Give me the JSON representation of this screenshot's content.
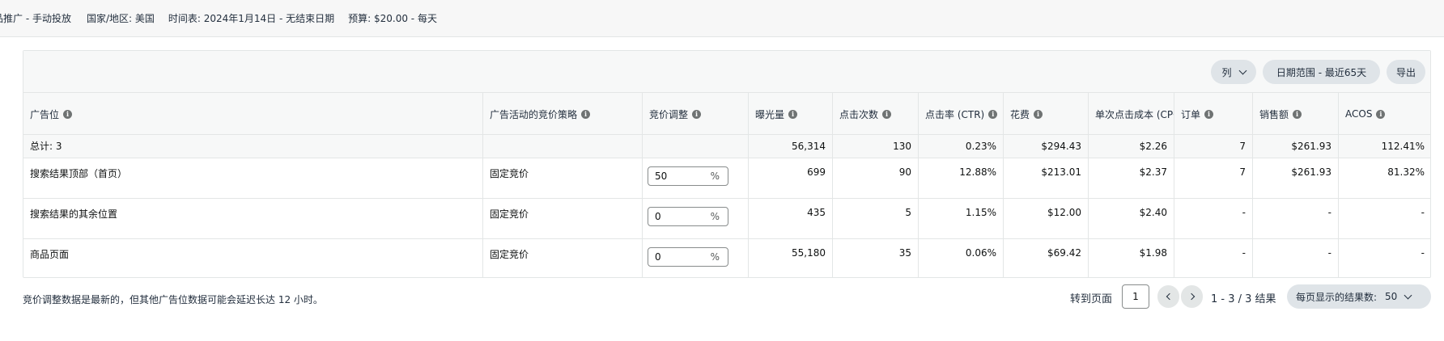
{
  "header": {
    "campaign_type": "品推广 - 手动投放",
    "country": "国家/地区: 美国",
    "schedule": "时间表: 2024年1月14日 - 无结束日期",
    "budget": "预算: $20.00 - 每天"
  },
  "toolbar": {
    "columns_label": "列",
    "date_range_label": "日期范围 - 最近65天",
    "export_label": "导出"
  },
  "table": {
    "headers": [
      "广告位",
      "广告活动的竞价策略",
      "竞价调整",
      "曝光量",
      "点击次数",
      "点击率 (CTR)",
      "花费",
      "单次点击成本 (CPC)",
      "订单",
      "销售额",
      "ACOS"
    ],
    "total": {
      "label": "总计: 3",
      "impressions": "56,314",
      "clicks": "130",
      "ctr": "0.23%",
      "spend": "$294.43",
      "cpc": "$2.26",
      "orders": "7",
      "sales": "$261.93",
      "acos": "112.41%"
    },
    "rows": [
      {
        "placement": "搜索结果顶部（首页）",
        "strategy": "固定竞价",
        "bid_value": "50",
        "bid_unit": "%",
        "impressions": "699",
        "clicks": "90",
        "ctr": "12.88%",
        "spend": "$213.01",
        "cpc": "$2.37",
        "orders": "7",
        "sales": "$261.93",
        "acos": "81.32%"
      },
      {
        "placement": "搜索结果的其余位置",
        "strategy": "固定竞价",
        "bid_value": "0",
        "bid_unit": "%",
        "impressions": "435",
        "clicks": "5",
        "ctr": "1.15%",
        "spend": "$12.00",
        "cpc": "$2.40",
        "orders": "-",
        "sales": "-",
        "acos": "-"
      },
      {
        "placement": "商品页面",
        "strategy": "固定竞价",
        "bid_value": "0",
        "bid_unit": "%",
        "impressions": "55,180",
        "clicks": "35",
        "ctr": "0.06%",
        "spend": "$69.42",
        "cpc": "$1.98",
        "orders": "-",
        "sales": "-",
        "acos": "-"
      }
    ]
  },
  "footer": {
    "note": "竞价调整数据是最新的，但其他广告位数据可能会延迟长达 12 小时。",
    "goto_label": "转到页面",
    "page_value": "1",
    "results": "1 - 3 / 3 结果",
    "per_page_label": "每页显示的结果数:",
    "per_page_value": "50"
  },
  "icons": {
    "info": "info-icon",
    "chevron": "chevron-down-icon",
    "prev": "chevron-left-icon",
    "next": "chevron-right-icon"
  },
  "colors": {
    "header_bg": "#f7f8f8",
    "pill_bg": "#dfe4e8",
    "border": "#e3e6e6",
    "text": "#0f1111"
  }
}
